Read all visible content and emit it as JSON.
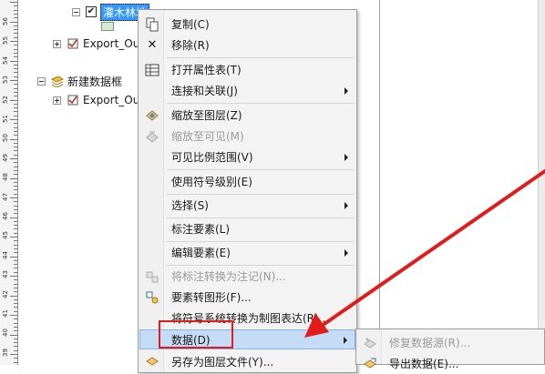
{
  "ruler": {
    "labels": [
      "56",
      "55",
      "54",
      "53",
      "52",
      "51",
      "50",
      "49",
      "48",
      "47",
      "46",
      "45",
      "44",
      "43",
      "42",
      "41",
      "40",
      "39"
    ]
  },
  "toc": {
    "layer1": {
      "label": "灌木林地",
      "checked": "✔"
    },
    "export1": {
      "label": "Export_Ou"
    },
    "data_frame": {
      "label": "新建数据框"
    },
    "export2": {
      "label": "Export_Ou"
    }
  },
  "context_menu": {
    "items": [
      {
        "label": "复制(C)",
        "icon": "copy-icon"
      },
      {
        "label": "移除(R)",
        "icon": "remove-icon",
        "glyph": "✕"
      },
      {
        "label": "打开属性表(T)",
        "icon": "table-icon"
      },
      {
        "label": "连接和关联(J)",
        "icon": "",
        "submenu": true
      },
      {
        "label": "缩放至图层(Z)",
        "icon": "zoom-to-layer-icon"
      },
      {
        "label": "缩放至可见(M)",
        "icon": "zoom-to-visible-icon",
        "disabled": true
      },
      {
        "label": "可见比例范围(V)",
        "icon": "",
        "submenu": true
      },
      {
        "label": "使用符号级别(E)",
        "icon": ""
      },
      {
        "label": "选择(S)",
        "icon": "",
        "submenu": true
      },
      {
        "label": "标注要素(L)",
        "icon": ""
      },
      {
        "label": "编辑要素(E)",
        "icon": "",
        "submenu": true
      },
      {
        "label": "将标注转换为注记(N)...",
        "icon": "convert-labels-icon",
        "disabled": true
      },
      {
        "label": "要素转图形(F)...",
        "icon": "features-to-graphics-icon"
      },
      {
        "label": "将符号系统转换为制图表达(R)...",
        "icon": ""
      },
      {
        "label": "数据(D)",
        "icon": "",
        "submenu": true,
        "highlighted": true
      },
      {
        "label": "另存为图层文件(Y)...",
        "icon": "save-layer-icon"
      }
    ]
  },
  "submenu": {
    "items": [
      {
        "label": "修复数据源(R)...",
        "icon": "repair-data-source-icon",
        "disabled": true
      },
      {
        "label": "导出数据(E)...",
        "icon": "export-data-icon"
      }
    ]
  },
  "colors": {
    "highlight": "#c5dcf6",
    "annotation_red": "#e21b1b",
    "selection": "#3399ff"
  }
}
